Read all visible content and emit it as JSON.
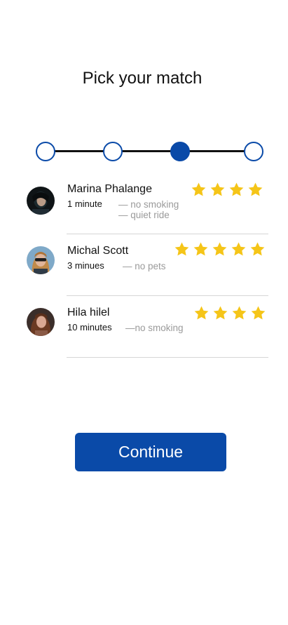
{
  "page": {
    "title": "Pick your match"
  },
  "stepper": {
    "steps": [
      {
        "state": "incomplete"
      },
      {
        "state": "incomplete"
      },
      {
        "state": "current"
      },
      {
        "state": "incomplete"
      }
    ],
    "current_index": 2
  },
  "matches": [
    {
      "name": "Marina Phalange",
      "eta": "1 minute",
      "preferences": [
        "— no smoking",
        "— quiet ride"
      ],
      "rating": 4,
      "avatar": "avatar-dark-hair"
    },
    {
      "name": "Michal Scott",
      "eta": "3 minues",
      "preferences": [
        "— no pets"
      ],
      "rating": 5,
      "avatar": "avatar-blonde-sunglasses"
    },
    {
      "name": "Hila hilel",
      "eta": "10 minutes",
      "preferences": [
        "—no smoking"
      ],
      "rating": 4,
      "avatar": "avatar-brown-hair"
    }
  ],
  "actions": {
    "continue_label": "Continue"
  },
  "colors": {
    "primary": "#0a4aa8",
    "star": "#f5c518",
    "muted_text": "#9a9a9a"
  }
}
